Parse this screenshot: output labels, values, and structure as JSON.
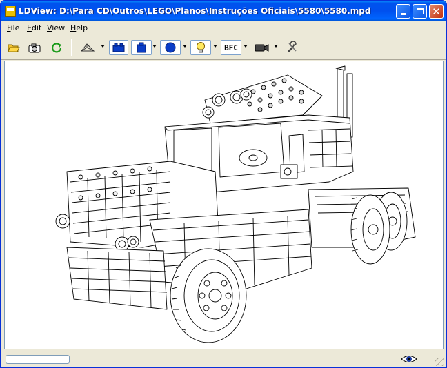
{
  "window": {
    "title": "LDView: D:\\Para CD\\Outros\\LEGO\\Planos\\Instruções Oficiais\\5580\\5580.mpd"
  },
  "menu": [
    {
      "pre": "",
      "key": "F",
      "post": "ile"
    },
    {
      "pre": "",
      "key": "E",
      "post": "dit"
    },
    {
      "pre": "",
      "key": "V",
      "post": "iew"
    },
    {
      "pre": "",
      "key": "H",
      "post": "elp"
    }
  ],
  "toolbar": {
    "icons": [
      "open-folder-icon",
      "snapshot-camera-icon",
      "reload-icon",
      "wireframe-icon",
      "seams-icon",
      "edges-icon",
      "primitive-substitution-icon",
      "lighting-icon",
      "bfc-icon",
      "view-camera-icon",
      "preferences-icon"
    ],
    "bfc_label": "BFC"
  },
  "colors": {
    "titlebar": "#0054e3",
    "pressed_border": "#7da2ce",
    "brick_blue": "#0a3dc7",
    "light_yellow": "#ffe960"
  }
}
